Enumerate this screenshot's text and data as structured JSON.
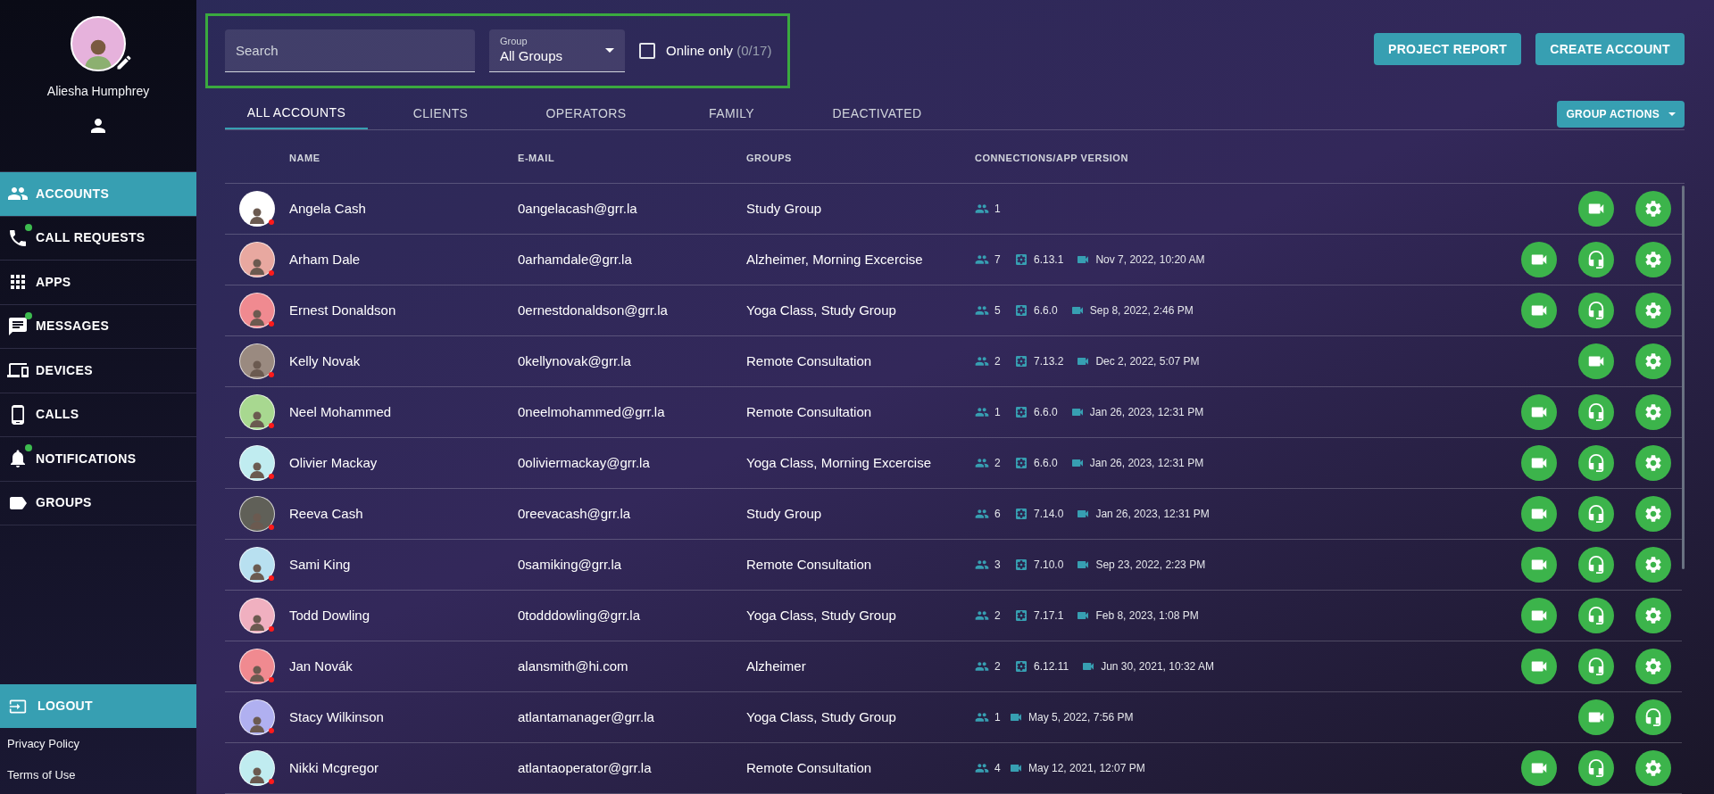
{
  "user": {
    "name": "Aliesha Humphrey"
  },
  "nav": [
    {
      "label": "ACCOUNTS",
      "kind": "people",
      "selected": true,
      "badge": false
    },
    {
      "label": "CALL REQUESTS",
      "kind": "phone",
      "selected": false,
      "badge": true
    },
    {
      "label": "APPS",
      "kind": "apps",
      "selected": false,
      "badge": false
    },
    {
      "label": "MESSAGES",
      "kind": "chat",
      "selected": false,
      "badge": true
    },
    {
      "label": "DEVICES",
      "kind": "devices",
      "selected": false,
      "badge": false
    },
    {
      "label": "CALLS",
      "kind": "mobile",
      "selected": false,
      "badge": false
    },
    {
      "label": "NOTIFICATIONS",
      "kind": "bell",
      "selected": false,
      "badge": true
    },
    {
      "label": "GROUPS",
      "kind": "label",
      "selected": false,
      "badge": false
    }
  ],
  "logout": "LOGOUT",
  "footer_links": [
    "Privacy Policy",
    "Terms of Use"
  ],
  "filters": {
    "search": {
      "placeholder": "Search"
    },
    "group": {
      "label": "Group",
      "value": "All Groups"
    },
    "online_only": {
      "label": "Online only",
      "count": "(0/17)",
      "checked": false
    }
  },
  "buttons": [
    "PROJECT REPORT",
    "CREATE ACCOUNT"
  ],
  "tabs": [
    {
      "label": "ALL ACCOUNTS",
      "selected": true
    },
    {
      "label": "CLIENTS",
      "selected": false
    },
    {
      "label": "OPERATORS",
      "selected": false
    },
    {
      "label": "FAMILY",
      "selected": false
    },
    {
      "label": "DEACTIVATED",
      "selected": false
    }
  ],
  "group_actions": "GROUP ACTIONS",
  "table": {
    "columns": [
      "NAME",
      "E-MAIL",
      "GROUPS",
      "CONNECTIONS/APP VERSION"
    ],
    "rows": [
      {
        "name": "Angela Cash",
        "email": "0angelacash@grr.la",
        "groups": "Study Group",
        "connections": "1",
        "online": false,
        "color": "#ffffff",
        "actions": [
          {
            "kind": "video"
          },
          {
            "kind": "settings"
          }
        ]
      },
      {
        "name": "Arham Dale",
        "email": "0arhamdale@grr.la",
        "groups": "Alzheimer, Morning Excercise",
        "connections": "7",
        "version": "6.13.1",
        "last_call": "Nov 7, 2022, 10:20 AM",
        "online": false,
        "color": "#e8a8a0",
        "actions": [
          {
            "kind": "video"
          },
          {
            "kind": "headset"
          },
          {
            "kind": "settings"
          }
        ]
      },
      {
        "name": "Ernest Donaldson",
        "email": "0ernestdonaldson@grr.la",
        "groups": "Yoga Class, Study Group",
        "connections": "5",
        "version": "6.6.0",
        "last_call": "Sep 8, 2022, 2:46 PM",
        "online": false,
        "color": "#f08a90",
        "actions": [
          {
            "kind": "video"
          },
          {
            "kind": "headset"
          },
          {
            "kind": "settings"
          }
        ]
      },
      {
        "name": "Kelly Novak",
        "email": "0kellynovak@grr.la",
        "groups": "Remote Consultation",
        "connections": "2",
        "version": "7.13.2",
        "last_call": "Dec 2, 2022, 5:07 PM",
        "online": false,
        "color": "#9a8a80",
        "actions": [
          {
            "kind": "video"
          },
          {
            "kind": "settings"
          }
        ]
      },
      {
        "name": "Neel Mohammed",
        "email": "0neelmohammed@grr.la",
        "groups": "Remote Consultation",
        "connections": "1",
        "version": "6.6.0",
        "last_call": "Jan 26, 2023, 12:31 PM",
        "online": false,
        "color": "#a8d890",
        "actions": [
          {
            "kind": "video"
          },
          {
            "kind": "headset"
          },
          {
            "kind": "settings"
          }
        ]
      },
      {
        "name": "Olivier Mackay",
        "email": "0oliviermackay@grr.la",
        "groups": "Yoga Class, Morning Excercise",
        "connections": "2",
        "version": "6.6.0",
        "last_call": "Jan 26, 2023, 12:31 PM",
        "online": false,
        "color": "#c0ecf0",
        "actions": [
          {
            "kind": "video"
          },
          {
            "kind": "headset"
          },
          {
            "kind": "settings"
          }
        ]
      },
      {
        "name": "Reeva Cash",
        "email": "0reevacash@grr.la",
        "groups": "Study Group",
        "connections": "6",
        "version": "7.14.0",
        "last_call": "Jan 26, 2023, 12:31 PM",
        "online": false,
        "color": "#606058",
        "actions": [
          {
            "kind": "video"
          },
          {
            "kind": "headset"
          },
          {
            "kind": "settings"
          }
        ]
      },
      {
        "name": "Sami King",
        "email": "0samiking@grr.la",
        "groups": "Remote Consultation",
        "connections": "3",
        "version": "7.10.0",
        "last_call": "Sep 23, 2022, 2:23 PM",
        "online": false,
        "color": "#b8e0f0",
        "actions": [
          {
            "kind": "video"
          },
          {
            "kind": "headset"
          },
          {
            "kind": "settings"
          }
        ]
      },
      {
        "name": "Todd Dowling",
        "email": "0todddowling@grr.la",
        "groups": "Yoga Class, Study Group",
        "connections": "2",
        "version": "7.17.1",
        "last_call": "Feb 8, 2023, 1:08 PM",
        "online": false,
        "color": "#f0b0c0",
        "actions": [
          {
            "kind": "video"
          },
          {
            "kind": "headset"
          },
          {
            "kind": "settings"
          }
        ]
      },
      {
        "name": "Jan Novák",
        "email": "alansmith@hi.com",
        "groups": "Alzheimer",
        "connections": "2",
        "version": "6.12.11",
        "last_call": "Jun 30, 2021, 10:32 AM",
        "online": false,
        "color": "#f08a90",
        "actions": [
          {
            "kind": "video"
          },
          {
            "kind": "headset"
          },
          {
            "kind": "settings"
          }
        ]
      },
      {
        "name": "Stacy Wilkinson",
        "email": "atlantamanager@grr.la",
        "groups": "Yoga Class, Study Group",
        "connections": "1",
        "last_call": "May 5, 2022, 7:56 PM",
        "online": false,
        "color": "#b0b0f0",
        "actions": [
          {
            "kind": "video"
          },
          {
            "kind": "headset"
          }
        ]
      },
      {
        "name": "Nikki Mcgregor",
        "email": "atlantaoperator@grr.la",
        "groups": "Remote Consultation",
        "connections": "4",
        "last_call": "May 12, 2021, 12:07 PM",
        "online": false,
        "color": "#c0ecf0",
        "actions": [
          {
            "kind": "video"
          },
          {
            "kind": "headset"
          },
          {
            "kind": "settings"
          }
        ]
      }
    ]
  }
}
